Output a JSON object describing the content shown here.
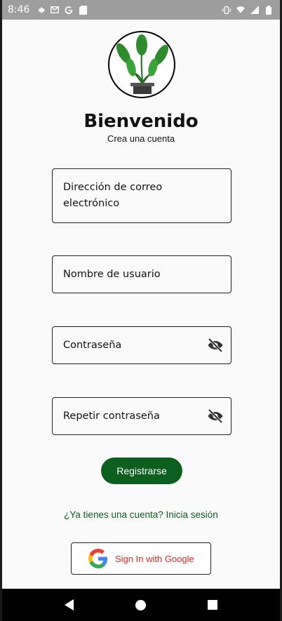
{
  "status_bar": {
    "time": "8:46",
    "icons": [
      "gear-icon",
      "gmail-icon",
      "google-icon",
      "sd-card-icon",
      "vibrate-icon",
      "wifi-icon",
      "signal-icon",
      "battery-icon"
    ]
  },
  "header": {
    "title": "Bienvenido",
    "subtitle": "Crea una cuenta"
  },
  "form": {
    "email_label": "Dirección de correo electrónico",
    "username_label": "Nombre de usuario",
    "password_label": "Contraseña",
    "repeat_password_label": "Repetir contraseña"
  },
  "actions": {
    "register_label": "Registrarse",
    "login_link": "¿Ya tienes una cuenta? Inicia sesión",
    "google_label": "Sign In with Google"
  },
  "colors": {
    "primary_green": "#0d5f1f",
    "google_text_red": "#d6291d",
    "status_bar": "#9e9e9e"
  }
}
